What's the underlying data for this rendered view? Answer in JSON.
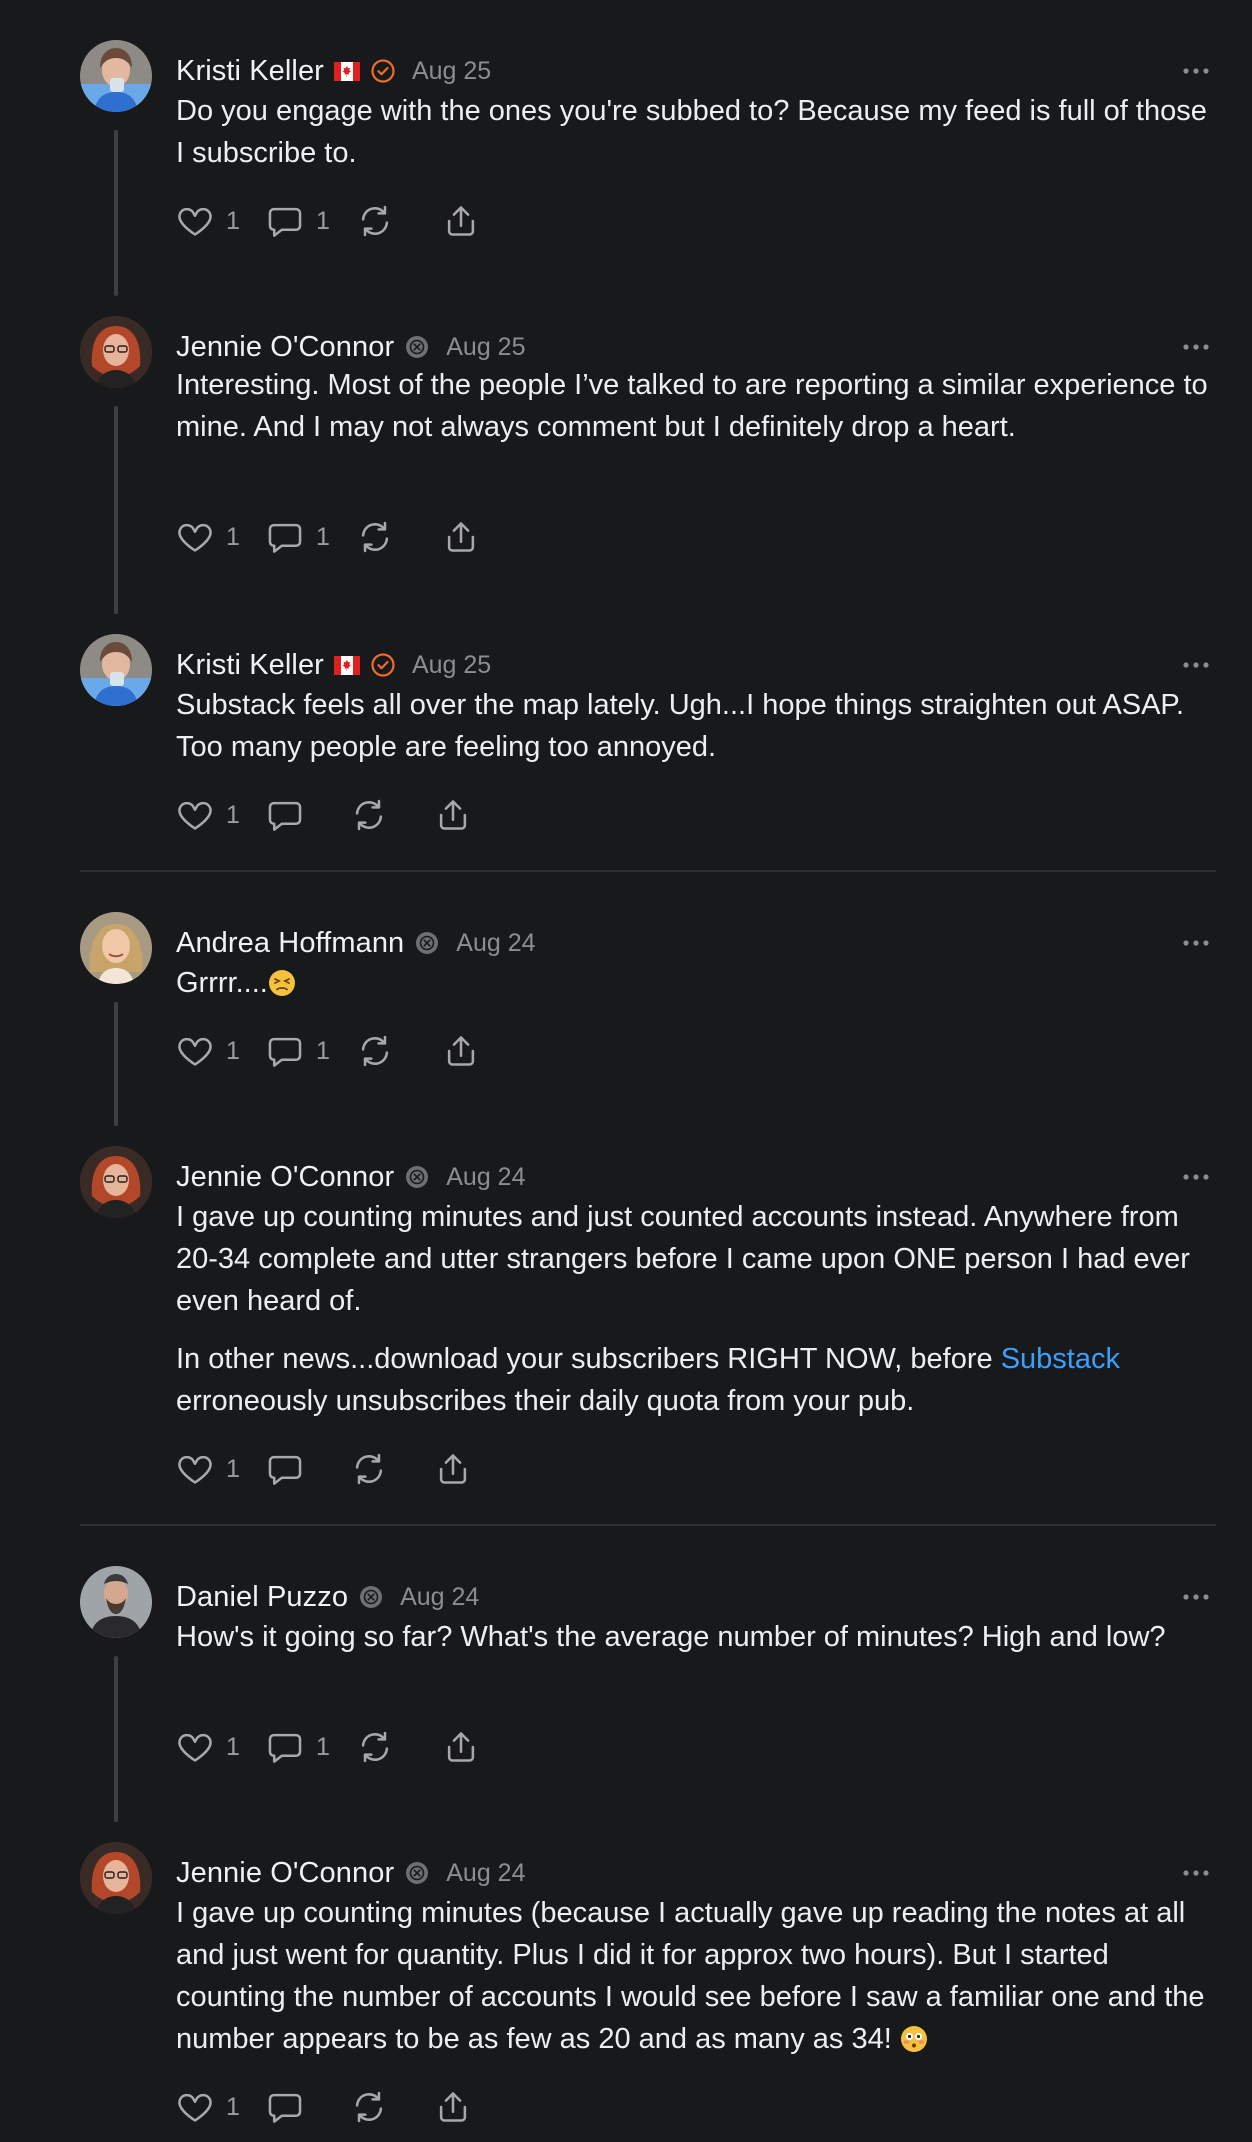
{
  "comments": [
    {
      "author": "Kristi Keller",
      "date": "Aug 25",
      "text": [
        "Do you engage with the ones you're subbed to? Because my feed is full of those I subscribe to."
      ],
      "likes": "1",
      "replies": "1"
    },
    {
      "author": "Jennie O'Connor",
      "date": "Aug 25",
      "text": [
        "Interesting. Most of the people I’ve talked to are reporting a similar experience to mine. And I may not always comment but I definitely drop a heart."
      ],
      "likes": "1",
      "replies": "1"
    },
    {
      "author": "Kristi Keller",
      "date": "Aug 25",
      "text": [
        "Substack feels all over the map lately. Ugh...I hope things straighten out ASAP. Too many people are feeling too annoyed."
      ],
      "likes": "1",
      "replies": ""
    },
    {
      "author": "Andrea Hoffmann",
      "date": "Aug 24",
      "text": [
        "Grrrr...."
      ],
      "likes": "1",
      "replies": "1"
    },
    {
      "author": "Jennie O'Connor",
      "date": "Aug 24",
      "text": [
        "I gave up counting minutes and just counted accounts instead. Anywhere from 20-34 complete and utter strangers before I came upon ONE person I had ever even heard of.",
        "In other news...download your subscribers RIGHT NOW, before ",
        "erroneously unsubscribes their daily quota from your pub."
      ],
      "link": "Substack",
      "likes": "1",
      "replies": ""
    },
    {
      "author": "Daniel Puzzo",
      "date": "Aug 24",
      "text": [
        "How's it going so far? What's the average number of minutes? High and low?"
      ],
      "likes": "1",
      "replies": "1"
    },
    {
      "author": "Jennie O'Connor",
      "date": "Aug 24",
      "text": [
        "I gave up counting minutes (because I actually gave up reading the notes at all and just went for quantity. Plus I did it for approx two hours). But I started counting the number of accounts I would see before I saw a familiar one and the number appears to be as few as 20 and as many as 34!"
      ],
      "likes": "1",
      "replies": ""
    }
  ],
  "colors": {
    "background": "#18191b",
    "link": "#3aa0ff",
    "verified_badge": "#ef6a2c",
    "muted": "#8b8d91"
  },
  "icons": [
    "heart-icon",
    "comment-icon",
    "restack-icon",
    "share-icon",
    "more-icon",
    "canada-flag-icon",
    "verified-check-icon",
    "subscriber-badge-icon",
    "persevering-face-emoji",
    "flushed-face-emoji"
  ]
}
